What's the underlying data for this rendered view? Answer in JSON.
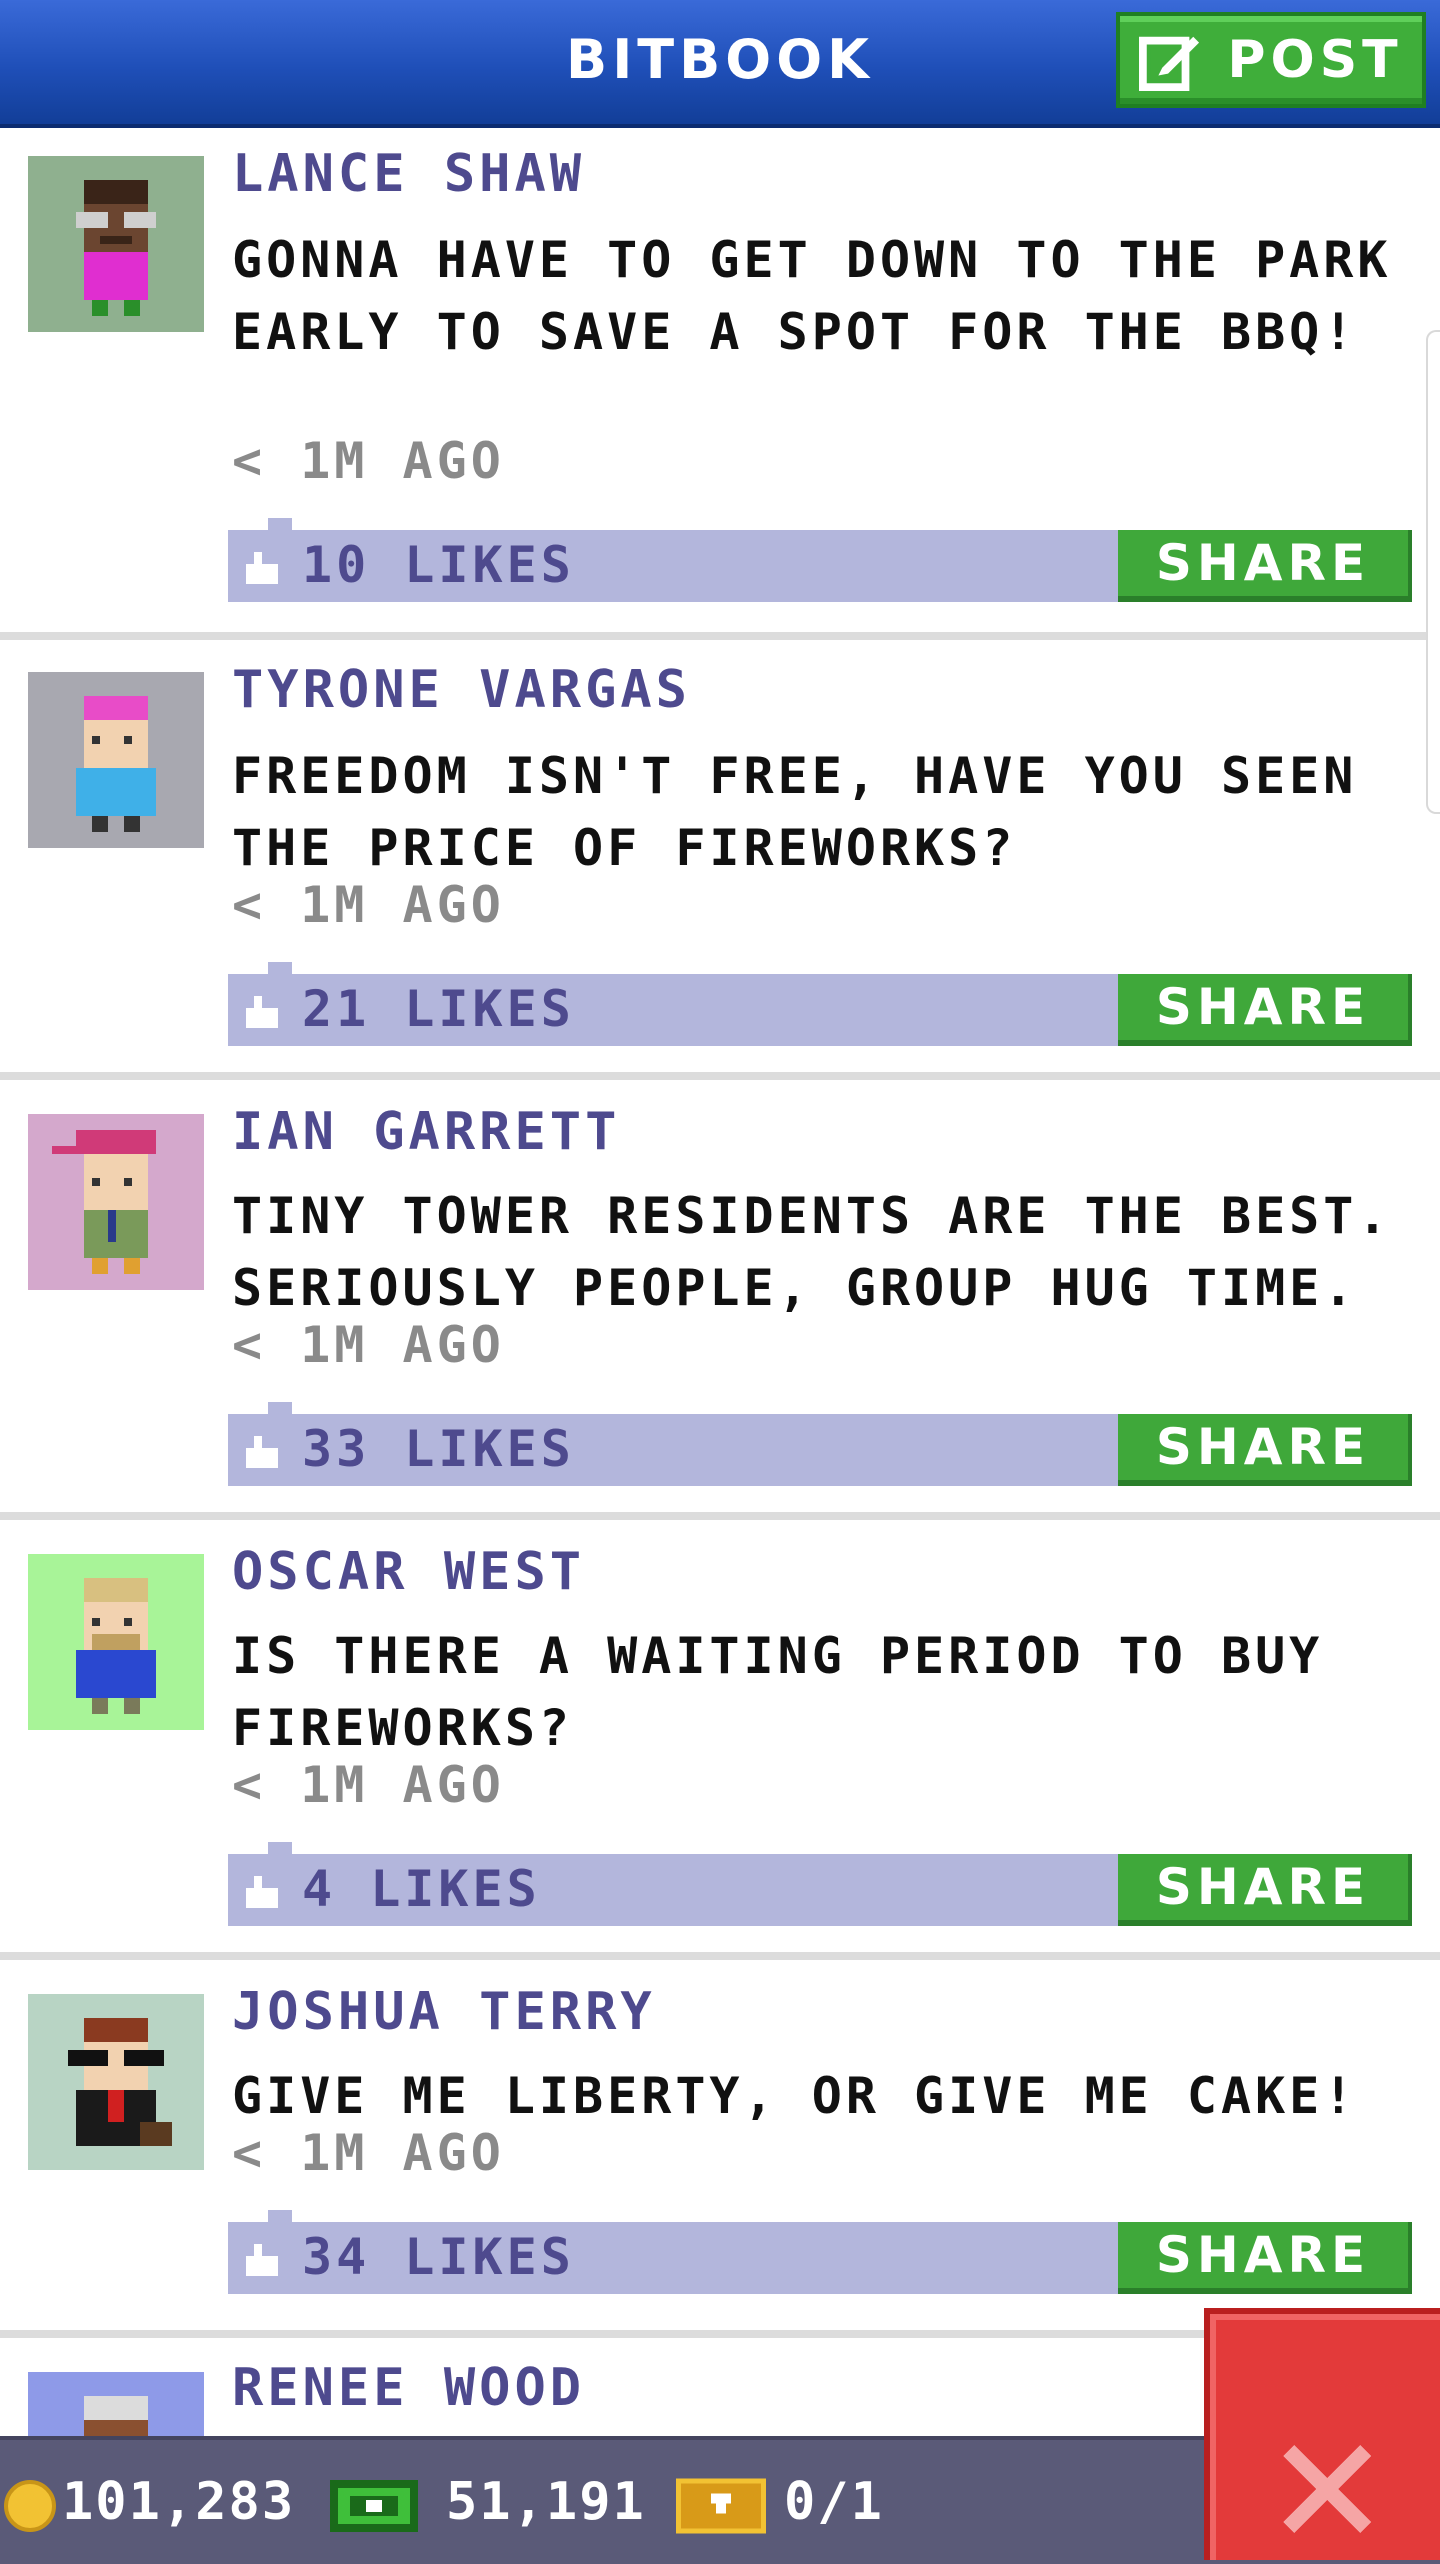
{
  "header": {
    "title": "BITBOOK",
    "post_label": "POST"
  },
  "posts": [
    {
      "name": "LANCE SHAW",
      "message": "GONNA HAVE TO GET DOWN TO THE PARK EARLY TO SAVE A SPOT FOR THE BBQ!",
      "time": "< 1M AGO",
      "likes": "10 LIKES",
      "share_label": "SHARE",
      "avatar_bg": "#8fb08f"
    },
    {
      "name": "TYRONE VARGAS",
      "message": "FREEDOM ISN'T FREE, HAVE YOU SEEN THE PRICE OF FIREWORKS?",
      "time": "< 1M AGO",
      "likes": "21 LIKES",
      "share_label": "SHARE",
      "avatar_bg": "#a8a8b0"
    },
    {
      "name": "IAN GARRETT",
      "message": "TINY TOWER RESIDENTS ARE THE BEST. SERIOUSLY PEOPLE, GROUP HUG TIME.",
      "time": "< 1M AGO",
      "likes": "33 LIKES",
      "share_label": "SHARE",
      "avatar_bg": "#d4a8cc"
    },
    {
      "name": "OSCAR WEST",
      "message": "IS THERE A WAITING PERIOD TO BUY FIREWORKS?",
      "time": "< 1M AGO",
      "likes": "4 LIKES",
      "share_label": "SHARE",
      "avatar_bg": "#a8f498"
    },
    {
      "name": "JOSHUA TERRY",
      "message": "GIVE ME LIBERTY, OR GIVE ME CAKE!",
      "time": "< 1M AGO",
      "likes": "34 LIKES",
      "share_label": "SHARE",
      "avatar_bg": "#b8d4c4"
    },
    {
      "name": "RENEE WOOD",
      "avatar_bg": "#8e9ae8"
    }
  ],
  "status_bar": {
    "coins": "101,283",
    "bux": "51,191",
    "tickets": "0/1"
  },
  "colors": {
    "header_blue": "#1f4fb8",
    "green": "#3fae3a",
    "likes_bar": "#b3b6dc",
    "name_purple": "#4e4a8e",
    "close_red": "#e33a3a"
  },
  "icons": [
    "compose-icon",
    "like-icon",
    "coin-icon",
    "cash-icon",
    "ticket-icon",
    "close-icon"
  ]
}
